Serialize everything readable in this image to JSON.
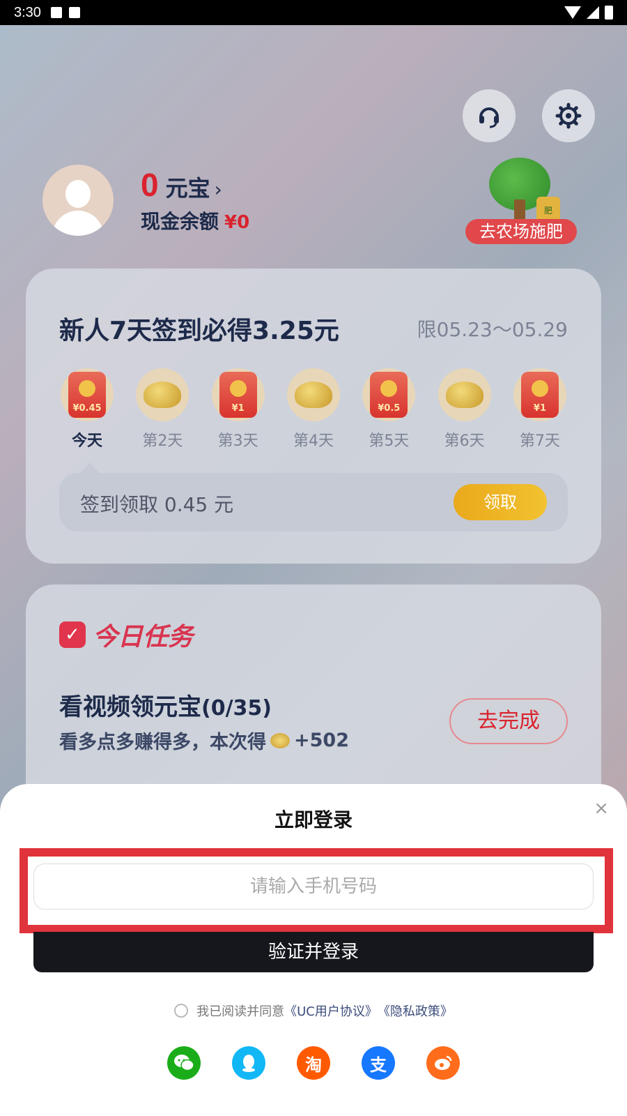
{
  "status_bar": {
    "time": "3:30"
  },
  "header": {
    "support_icon": "headset-icon",
    "settings_icon": "gear-icon",
    "coins_value": "0",
    "coins_unit": "元宝",
    "coins_chevron": "›",
    "cash_label": "现金余额",
    "cash_value": "¥0",
    "farm_label": "去农场施肥",
    "farm_bag_text": "肥"
  },
  "signin": {
    "title": "新人7天签到必得3.25元",
    "range": "限05.23～05.29",
    "days": [
      {
        "label": "今天",
        "reward": "¥0.45",
        "type": "redpacket"
      },
      {
        "label": "第2天",
        "reward": "",
        "type": "ingot"
      },
      {
        "label": "第3天",
        "reward": "¥1",
        "type": "redpacket"
      },
      {
        "label": "第4天",
        "reward": "",
        "type": "ingot"
      },
      {
        "label": "第5天",
        "reward": "¥0.5",
        "type": "redpacket"
      },
      {
        "label": "第6天",
        "reward": "",
        "type": "ingot"
      },
      {
        "label": "第7天",
        "reward": "¥1",
        "type": "redpacket"
      }
    ],
    "claim_text": "签到领取 0.45 元",
    "claim_button": "领取"
  },
  "tasks": {
    "header": "今日任务",
    "item_title": "看视频领元宝",
    "item_count": "(0/35)",
    "item_sub_prefix": "看多点多赚得多，本次得",
    "item_reward": "+502",
    "item_button": "去完成"
  },
  "login": {
    "close": "×",
    "title": "立即登录",
    "phone_placeholder": "请输入手机号码",
    "submit": "验证并登录",
    "agree_text": "我已阅读并同意",
    "agreement_link": "《UC用户协议》",
    "privacy_link": "《隐私政策》",
    "socials": [
      {
        "name": "wechat",
        "glyph": "",
        "color": "#1aad19"
      },
      {
        "name": "qq",
        "glyph": "",
        "color": "#12b7f5"
      },
      {
        "name": "taobao",
        "glyph": "淘",
        "color": "#ff5a00"
      },
      {
        "name": "alipay",
        "glyph": "支",
        "color": "#1677ff"
      },
      {
        "name": "weibo",
        "glyph": "",
        "color": "#ff6d1c"
      }
    ]
  }
}
